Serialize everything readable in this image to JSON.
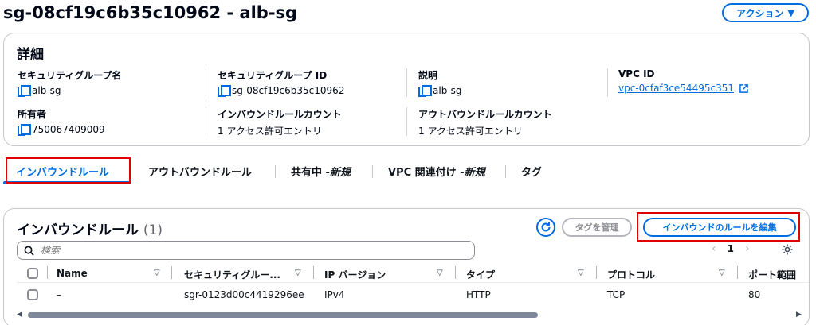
{
  "page": {
    "title": "sg-08cf19c6b35c10962 - alb-sg",
    "action_label": "アクション"
  },
  "details": {
    "title": "詳細",
    "fields": [
      {
        "label": "セキュリティグループ名",
        "value": "alb-sg"
      },
      {
        "label": "セキュリティグループ ID",
        "value": "sg-08cf19c6b35c10962"
      },
      {
        "label": "説明",
        "value": "alb-sg"
      },
      {
        "label": "VPC ID",
        "value": "vpc-0cfaf3ce54495c351"
      },
      {
        "label": "所有者",
        "value": "750067409009"
      },
      {
        "label": "インバウンドルールカウント",
        "value": "1 アクセス許可エントリ"
      },
      {
        "label": "アウトバウンドルールカウント",
        "value": "1 アクセス許可エントリ"
      }
    ]
  },
  "tabs": [
    {
      "label": "インバウンドルール",
      "active": true
    },
    {
      "label": "アウトバウンドルール"
    },
    {
      "label": "共有中 - ",
      "suffix": "新規"
    },
    {
      "label": "VPC 関連付け - ",
      "suffix": "新規"
    },
    {
      "label": "タグ"
    }
  ],
  "rules": {
    "title": "インバウンドルール",
    "count": "(1)",
    "manage_tags_label": "タグを管理",
    "edit_label": "インバウンドのルールを編集",
    "search_placeholder": "検索",
    "page_number": "1",
    "columns": [
      "Name",
      "セキュリティグルー...",
      "IP バージョン",
      "タイプ",
      "プロトコル",
      "ポート範囲"
    ],
    "rows": [
      {
        "name": "–",
        "rule_id": "sgr-0123d00c4419296ee",
        "ip_version": "IPv4",
        "type": "HTTP",
        "protocol": "TCP",
        "port": "80"
      }
    ]
  },
  "colors": {
    "accent": "#006ce0",
    "highlight": "#e00000",
    "text": "#0f141a"
  }
}
